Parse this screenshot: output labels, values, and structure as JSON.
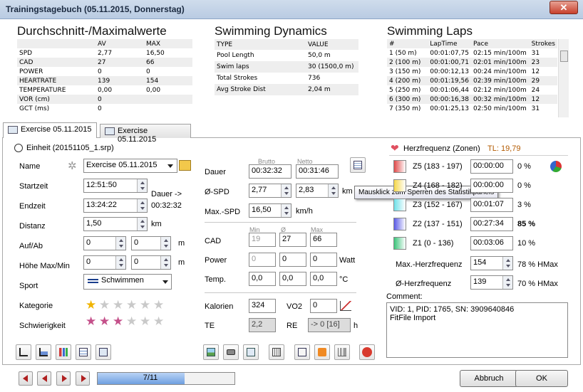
{
  "window": {
    "title": "Trainingstagebuch (05.11.2015, Donnerstag)",
    "close_glyph": "✕"
  },
  "summary": {
    "heading": "Durchschnitt-/Maximalwerte",
    "col_av": "AV",
    "col_max": "MAX",
    "rows": [
      {
        "name": "SPD",
        "av": "2,77",
        "max": "16,50"
      },
      {
        "name": "CAD",
        "av": "27",
        "max": "66"
      },
      {
        "name": "POWER",
        "av": "0",
        "max": "0"
      },
      {
        "name": "HEARTRATE",
        "av": "139",
        "max": "154"
      },
      {
        "name": "TEMPERATURE",
        "av": "0,00",
        "max": "0,00"
      },
      {
        "name": "VOR (cm)",
        "av": "0",
        "max": ""
      },
      {
        "name": "GCT (ms)",
        "av": "0",
        "max": ""
      }
    ]
  },
  "dynamics": {
    "heading": "Swimming Dynamics",
    "col_type": "TYPE",
    "col_value": "VALUE",
    "rows": [
      {
        "type": "Pool Length",
        "value": "50,0 m"
      },
      {
        "type": "Swim laps",
        "value": "30 (1500,0 m)"
      },
      {
        "type": "Total Strokes",
        "value": "736"
      },
      {
        "type": "Avg Stroke Dist",
        "value": "2,04 m"
      }
    ]
  },
  "laps": {
    "heading": "Swimming Laps",
    "cols": [
      "#",
      "LapTime",
      "Pace",
      "Strokes"
    ],
    "rows": [
      [
        "1 (50 m)",
        "00:01:07,75",
        "02:15 min/100m",
        "31"
      ],
      [
        "2 (100 m)",
        "00:01:00,71",
        "02:01 min/100m",
        "23"
      ],
      [
        "3 (150 m)",
        "00:00:12,13",
        "00:24 min/100m",
        "12"
      ],
      [
        "4 (200 m)",
        "00:01:19,56",
        "02:39 min/100m",
        "29"
      ],
      [
        "5 (250 m)",
        "00:01:06,44",
        "02:12 min/100m",
        "24"
      ],
      [
        "6 (300 m)",
        "00:00:16,38",
        "00:32 min/100m",
        "12"
      ],
      [
        "7 (350 m)",
        "00:01:25,13",
        "02:50 min/100m",
        "31"
      ]
    ]
  },
  "tabs": [
    {
      "label": "Exercise 05.11.2015"
    },
    {
      "label": "Exercise 05.11.2015"
    }
  ],
  "unit": {
    "label": "Einheit (20151105_1.srp)",
    "name_label": "Name",
    "name_value": "Exercise 05.11.2015",
    "start_label": "Startzeit",
    "start_value": "12:51:50",
    "end_label": "Endzeit",
    "end_value": "13:24:22",
    "duration_note_1": "Dauer ->",
    "duration_note_2": "00:32:32",
    "dist_label": "Distanz",
    "dist_value": "1,50",
    "dist_unit": "km",
    "updown_label": "Auf/Ab",
    "up_value": "0",
    "down_value": "0",
    "updown_unit": "m",
    "height_label": "Höhe Max/Min",
    "hmax_value": "0",
    "hmin_value": "0",
    "height_unit": "m",
    "sport_label": "Sport",
    "sport_value": "Schwimmen",
    "category_label": "Kategorie",
    "category_stars": 1,
    "difficulty_label": "Schwierigkeit",
    "difficulty_stars": 3
  },
  "stats": {
    "brutto_label": "Brutto",
    "netto_label": "Netto",
    "duration_label": "Dauer",
    "duration_brutto": "00:32:32",
    "duration_netto": "00:31:46",
    "spd_label": "Ø-SPD",
    "spd_brutto": "2,77",
    "spd_netto": "2,83",
    "spd_unit": "km",
    "maxspd_label": "Max.-SPD",
    "maxspd_value": "16,50",
    "maxspd_unit": "km/h",
    "min_label": "Min",
    "avg_label": "Ø",
    "max_label": "Max",
    "cad_label": "CAD",
    "cad_min": "19",
    "cad_avg": "27",
    "cad_max": "66",
    "power_label": "Power",
    "power_min": "0",
    "power_avg": "0",
    "power_max": "0",
    "power_unit": "Watt",
    "temp_label": "Temp.",
    "temp_min": "0,0",
    "temp_avg": "0,0",
    "temp_max": "0,0",
    "temp_unit": "°C",
    "kcal_label": "Kalorien",
    "kcal_value": "324",
    "vo2_label": "VO2",
    "vo2_value": "0",
    "te_label": "TE",
    "te_value": "2,2",
    "re_label": "RE",
    "re_value": "-> 0 [16]",
    "re_unit": "h"
  },
  "tooltip": "Mausklick zum Sperren des Statistikpanels",
  "heart": {
    "label": "Herzfrequenz (Zonen)",
    "tl": "TL: 19,79",
    "zones": [
      {
        "name": "Z5 (183 - 197)",
        "time": "00:00:00",
        "pct": "0 %",
        "color": "#e04a4a",
        "bold": false
      },
      {
        "name": "Z4 (168 - 182)",
        "time": "00:00:00",
        "pct": "0 %",
        "color": "#f5d84a",
        "bold": false
      },
      {
        "name": "Z3 (152 - 167)",
        "time": "00:01:07",
        "pct": "3 %",
        "color": "#6fe0e8",
        "bold": false
      },
      {
        "name": "Z2 (137 - 151)",
        "time": "00:27:34",
        "pct": "85 %",
        "color": "#5a5ae6",
        "bold": true
      },
      {
        "name": "Z1 (0 - 136)",
        "time": "00:03:06",
        "pct": "10 %",
        "color": "#3cc47a",
        "bold": false
      }
    ],
    "max_label": "Max.-Herzfrequenz",
    "max_value": "154",
    "max_pct": "78 % HMax",
    "avg_label": "Ø-Herzfrequenz",
    "avg_value": "139",
    "avg_pct": "70 % HMax"
  },
  "comment": {
    "label": "Comment:",
    "line1": "VID: 1, PID: 1765, SN: 3909640846",
    "line2": "FitFile Import"
  },
  "footer": {
    "progress_text": "7/11",
    "progress": 0.636,
    "cancel": "Abbruch",
    "ok": "OK"
  },
  "colors": {
    "accent": "#3a70c8",
    "title_bg": "#c8d7ea",
    "tl_color": "#b35a00"
  }
}
